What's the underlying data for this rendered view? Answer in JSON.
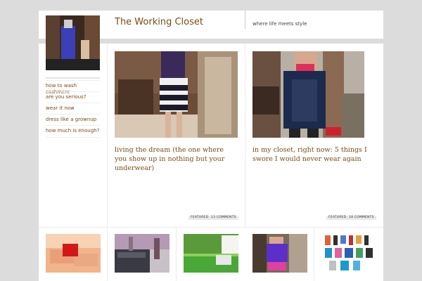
{
  "site": {
    "title": "The Working Closet",
    "tagline": "where life meets style"
  },
  "sidebar": {
    "items": [
      {
        "label": "how to wash cashmere"
      },
      {
        "label": "are you serious?"
      },
      {
        "label": "wear it now"
      },
      {
        "label": "dress like a grownup"
      },
      {
        "label": "how much is enough?"
      }
    ]
  },
  "posts": [
    {
      "title": "living the dream (the one where you show up in nothing but your underwear)",
      "badge": "FEATURED",
      "comments": "13 COMMENTS"
    },
    {
      "title": "in my closet, right now: 5 things I swore I would never wear again",
      "badge": "FEATURED",
      "comments": "18 COMMENTS"
    }
  ],
  "colors": {
    "background": "#dcdcdc",
    "panel": "#ffffff",
    "link": "#7a4b14",
    "title": "#7a4b14"
  }
}
